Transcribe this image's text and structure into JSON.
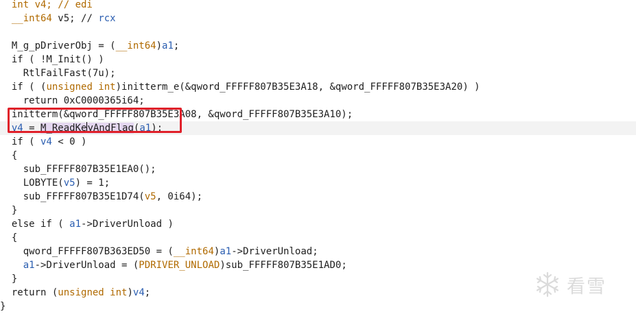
{
  "editor": {
    "lines": [
      {
        "tokens": [
          {
            "t": "  int v4; // edi",
            "c": "kw"
          }
        ]
      },
      {
        "tokens": [
          {
            "t": "  ",
            "c": "def"
          },
          {
            "t": "__int64",
            "c": "kw"
          },
          {
            "t": " v5; // ",
            "c": "def"
          },
          {
            "t": "rcx",
            "c": "var"
          }
        ]
      },
      {
        "tokens": [
          {
            "t": "",
            "c": "def"
          }
        ]
      },
      {
        "tokens": [
          {
            "t": "  M_g_pDriverObj = (",
            "c": "def"
          },
          {
            "t": "__int64",
            "c": "kw"
          },
          {
            "t": ")",
            "c": "def"
          },
          {
            "t": "a1",
            "c": "var"
          },
          {
            "t": ";",
            "c": "def"
          }
        ]
      },
      {
        "tokens": [
          {
            "t": "  if ( !M_Init() )",
            "c": "def"
          }
        ]
      },
      {
        "tokens": [
          {
            "t": "    RtlFailFast(7u);",
            "c": "def"
          }
        ]
      },
      {
        "tokens": [
          {
            "t": "  if ( (",
            "c": "def"
          },
          {
            "t": "unsigned int",
            "c": "kw"
          },
          {
            "t": ")initterm_e(&qword_FFFFF807B35E3A18, &qword_FFFFF807B35E3A20) )",
            "c": "def"
          }
        ]
      },
      {
        "tokens": [
          {
            "t": "    return 0xC0000365i64;",
            "c": "def"
          }
        ]
      },
      {
        "tokens": [
          {
            "t": "  initterm(&qword_FFFFF807B35E3A08, &qword_FFFFF807B35E3A10);",
            "c": "def"
          }
        ]
      },
      {
        "current": true,
        "tokens": [
          {
            "t": "  ",
            "c": "def"
          },
          {
            "t": "v4",
            "c": "var"
          },
          {
            "t": " = ",
            "c": "def"
          },
          {
            "t": "M_ReadKe",
            "c": "def",
            "hl": true
          },
          {
            "cursor": true
          },
          {
            "t": "yAndFlag",
            "c": "def",
            "hl": true
          },
          {
            "t": "(",
            "c": "def"
          },
          {
            "t": "a1",
            "c": "var"
          },
          {
            "t": ");",
            "c": "def"
          }
        ]
      },
      {
        "tokens": [
          {
            "t": "  if ( ",
            "c": "def"
          },
          {
            "t": "v4",
            "c": "var"
          },
          {
            "t": " < 0 )",
            "c": "def"
          }
        ]
      },
      {
        "tokens": [
          {
            "t": "  {",
            "c": "def"
          }
        ]
      },
      {
        "tokens": [
          {
            "t": "    sub_FFFFF807B35E1EA0();",
            "c": "def"
          }
        ]
      },
      {
        "tokens": [
          {
            "t": "    LOBYTE(",
            "c": "def"
          },
          {
            "t": "v5",
            "c": "var"
          },
          {
            "t": ") = 1;",
            "c": "def"
          }
        ]
      },
      {
        "tokens": [
          {
            "t": "    sub_FFFFF807B35E1D74(",
            "c": "def"
          },
          {
            "t": "v5",
            "c": "kw"
          },
          {
            "t": ", 0i64);",
            "c": "def"
          }
        ]
      },
      {
        "tokens": [
          {
            "t": "  }",
            "c": "def"
          }
        ]
      },
      {
        "tokens": [
          {
            "t": "  else if ( ",
            "c": "def"
          },
          {
            "t": "a1",
            "c": "var"
          },
          {
            "t": "->DriverUnload )",
            "c": "def"
          }
        ]
      },
      {
        "tokens": [
          {
            "t": "  {",
            "c": "def"
          }
        ]
      },
      {
        "tokens": [
          {
            "t": "    qword_FFFFF807B363ED50 = (",
            "c": "def"
          },
          {
            "t": "__int64",
            "c": "kw"
          },
          {
            "t": ")",
            "c": "def"
          },
          {
            "t": "a1",
            "c": "var"
          },
          {
            "t": "->DriverUnload;",
            "c": "def"
          }
        ]
      },
      {
        "tokens": [
          {
            "t": "    ",
            "c": "def"
          },
          {
            "t": "a1",
            "c": "var"
          },
          {
            "t": "->DriverUnload = (",
            "c": "def"
          },
          {
            "t": "PDRIVER_UNLOAD",
            "c": "kw"
          },
          {
            "t": ")sub_FFFFF807B35E1AD0;",
            "c": "def"
          }
        ]
      },
      {
        "tokens": [
          {
            "t": "  }",
            "c": "def"
          }
        ]
      },
      {
        "tokens": [
          {
            "t": "  return (",
            "c": "def"
          },
          {
            "t": "unsigned int",
            "c": "kw"
          },
          {
            "t": ")",
            "c": "def"
          },
          {
            "t": "v4",
            "c": "var"
          },
          {
            "t": ";",
            "c": "def"
          }
        ]
      },
      {
        "tokens": [
          {
            "t": "}",
            "c": "def"
          }
        ]
      }
    ]
  },
  "annotation": {
    "highlighted_line": 9,
    "color": "#e0202a"
  },
  "watermark": {
    "icon": "snowflake-icon",
    "text": "看雪"
  },
  "colors": {
    "keyword": "#b06a00",
    "variable": "#2a5db0",
    "text": "#1e1e1e",
    "current_line": "#f3f3f3",
    "token_highlight": "#e4d7f0"
  }
}
